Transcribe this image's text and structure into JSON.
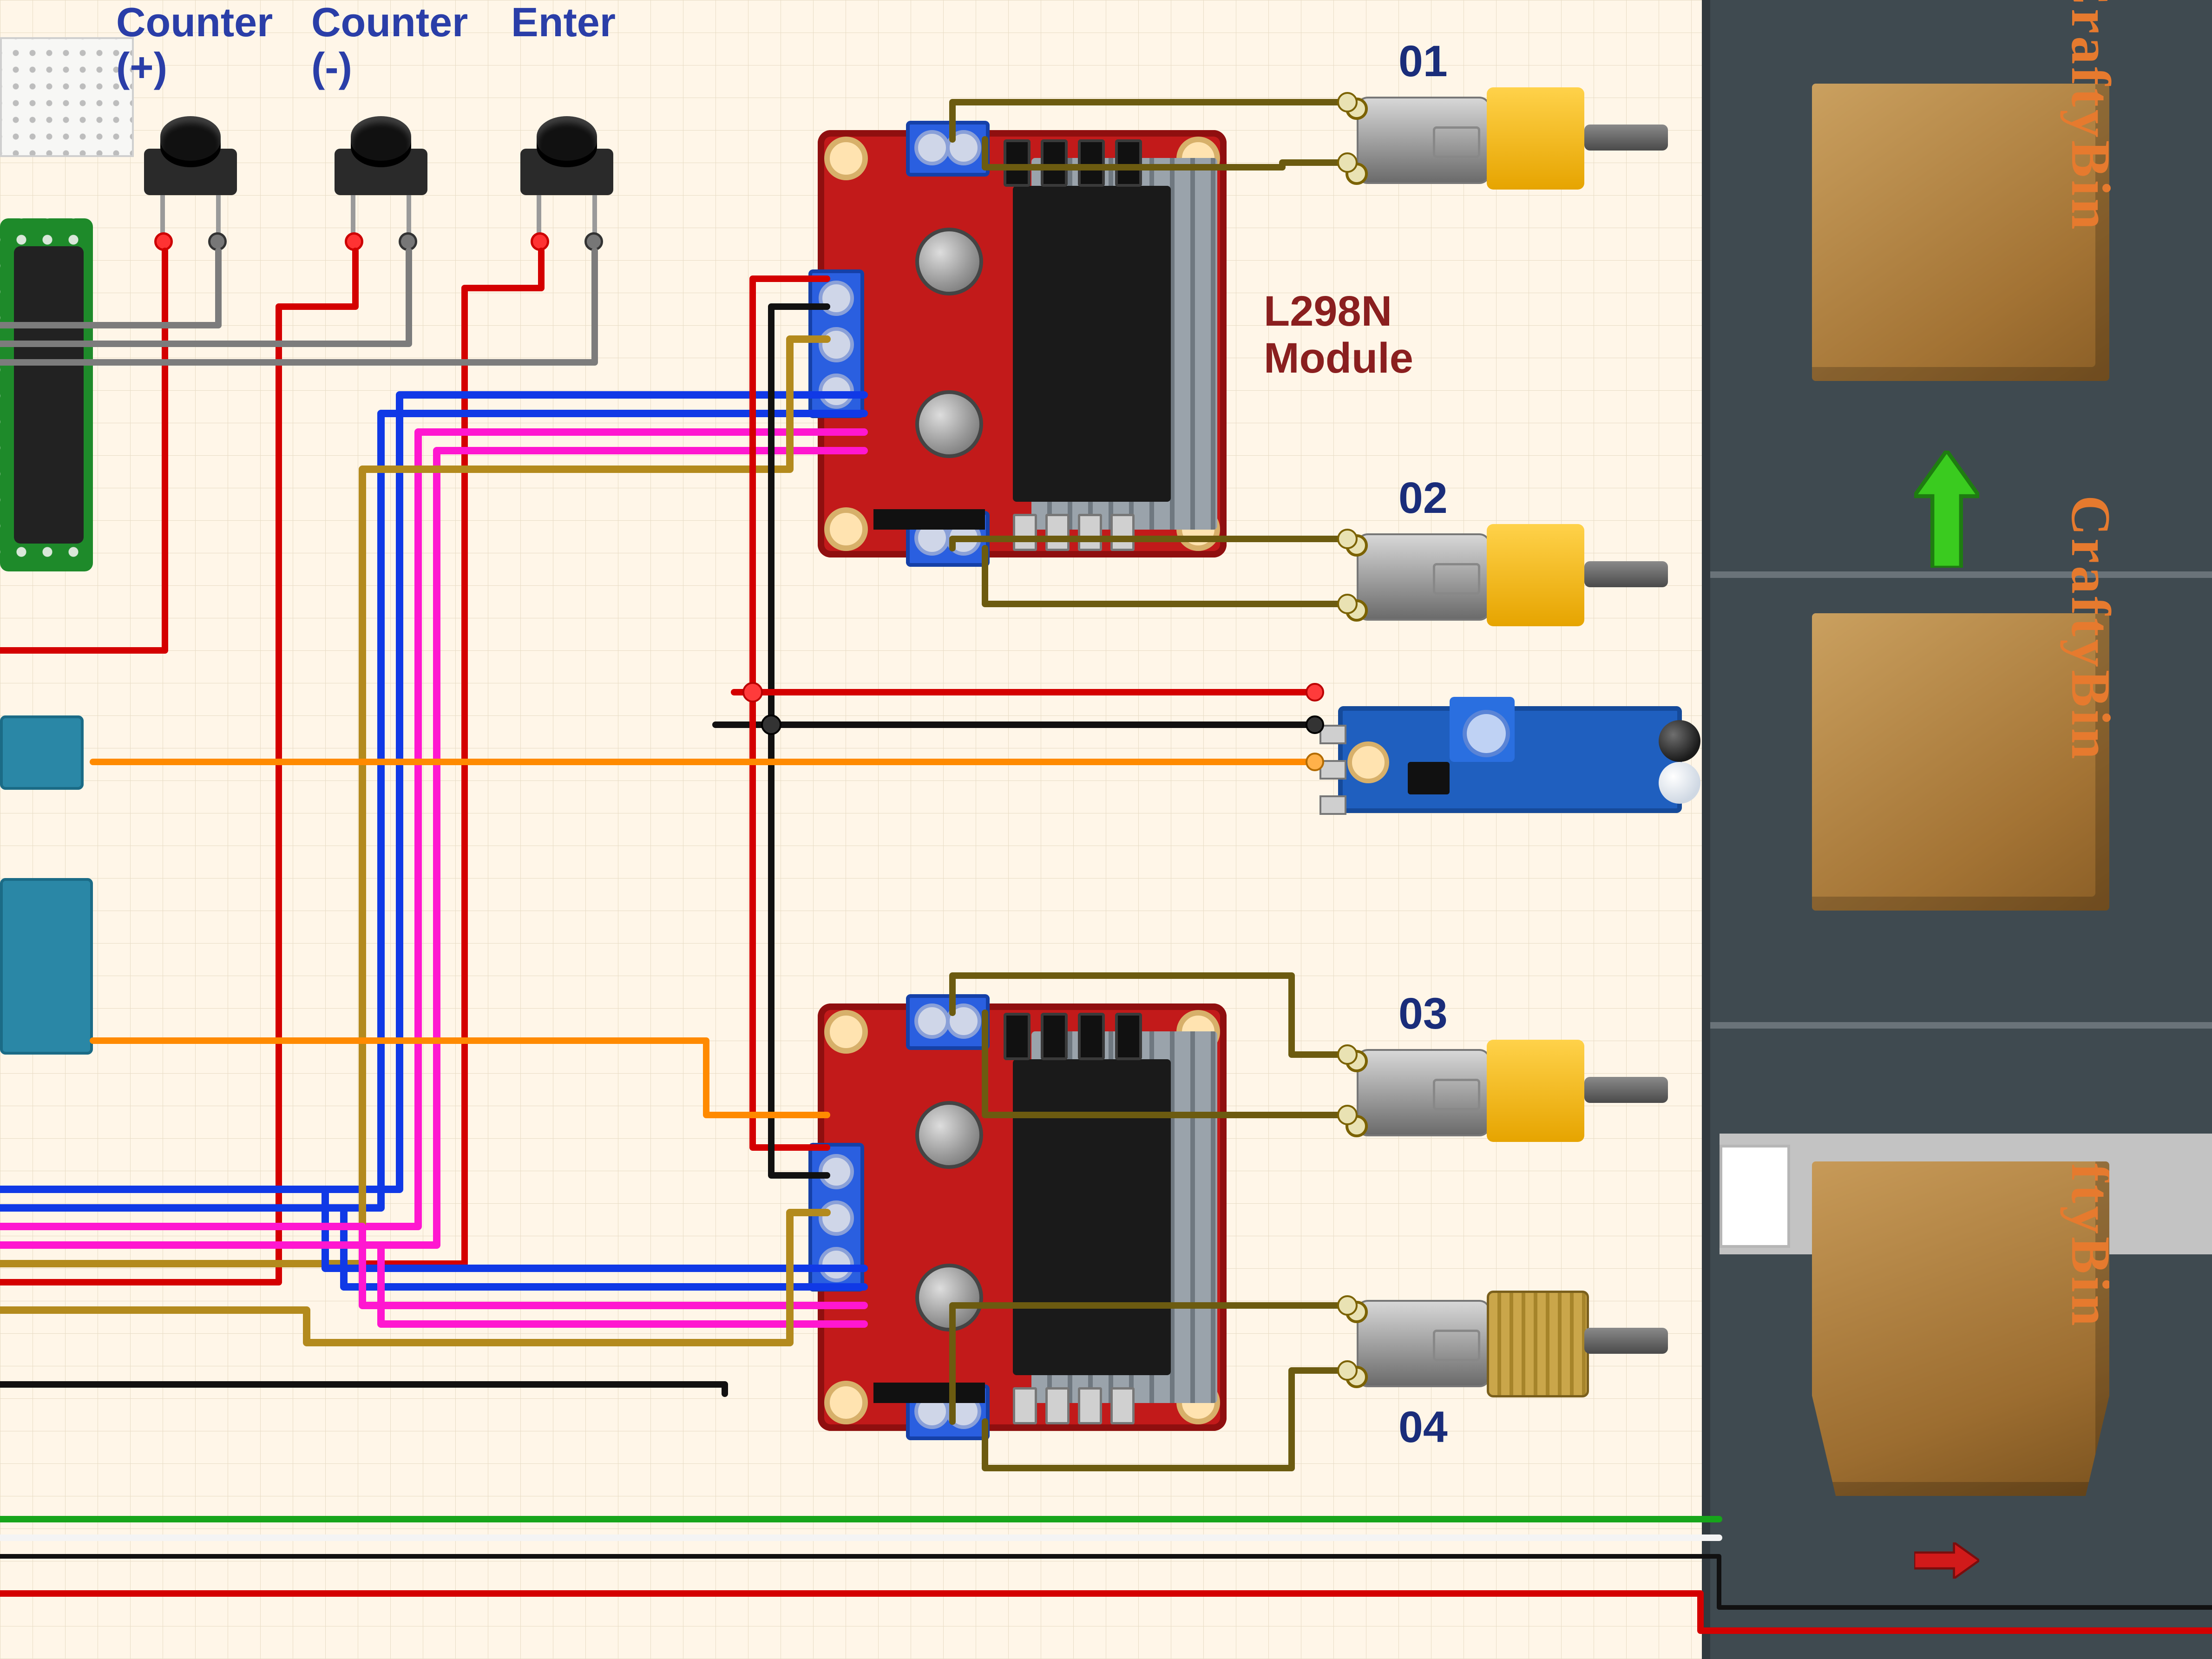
{
  "buttons": {
    "counter_plus": "Counter\n(+)",
    "counter_minus": "Counter\n(-)",
    "enter": "Enter"
  },
  "module_label": "L298N\nModule",
  "motors": {
    "m1": "01",
    "m2": "02",
    "m3": "03",
    "m4": "04"
  },
  "bin_label": "CraftyBin",
  "arrows": {
    "up_color": "#3acb1f",
    "down_color": "#d11a1a"
  }
}
